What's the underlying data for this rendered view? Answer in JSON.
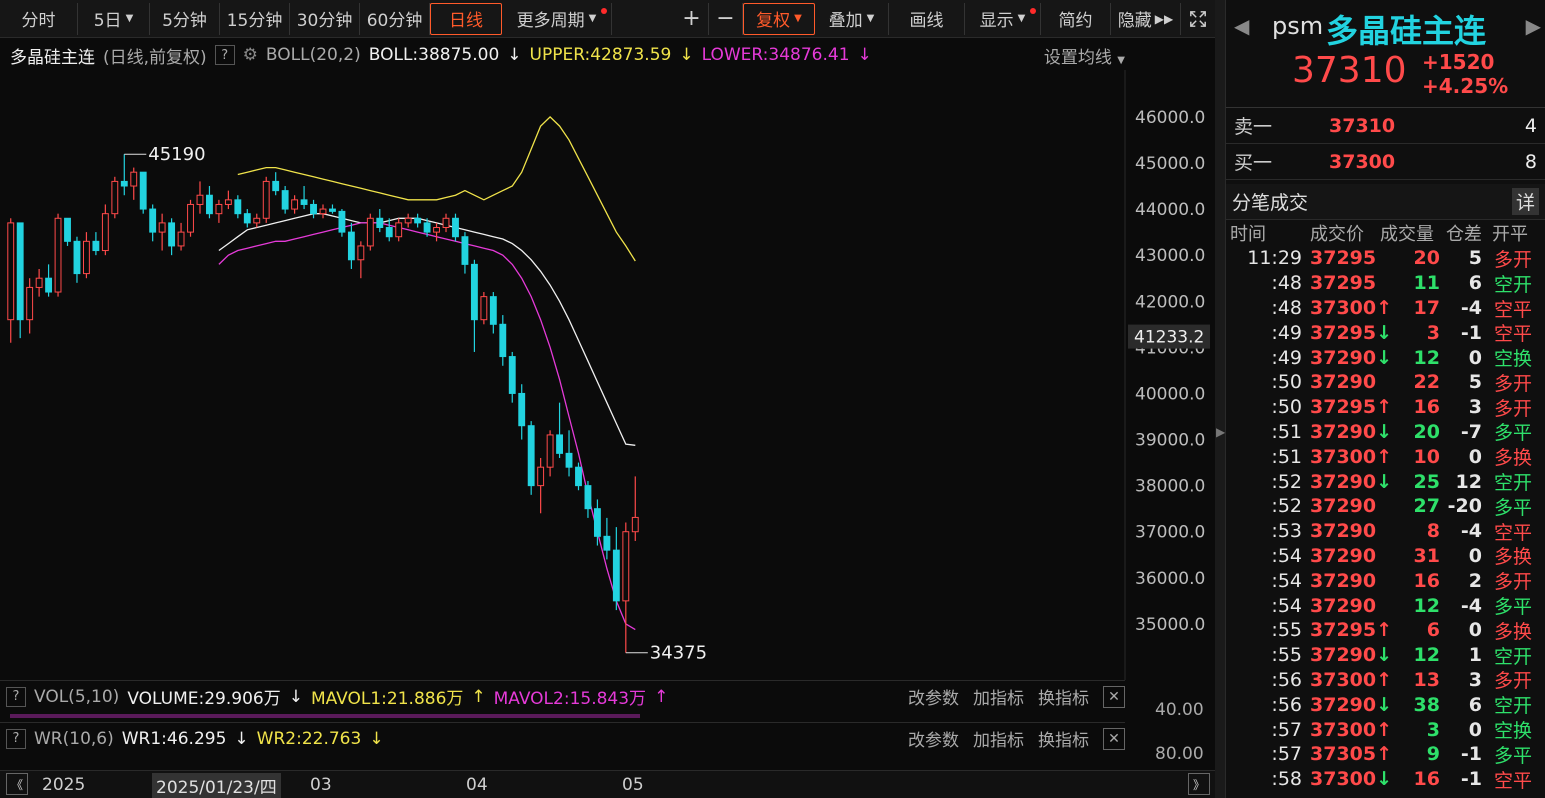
{
  "toolbar": {
    "periods": [
      "分时",
      "5日",
      "5分钟",
      "15分钟",
      "30分钟",
      "60分钟",
      "日线",
      "更多周期"
    ],
    "active_period": "日线",
    "tools": [
      "+",
      "−",
      "复权",
      "叠加",
      "画线",
      "显示",
      "简约",
      "隐藏"
    ]
  },
  "legend": {
    "symbol": "多晶硅主连",
    "mode": "(日线,前复权)",
    "indicator": "BOLL(20,2)",
    "boll": "BOLL:38875.00",
    "upper": "UPPER:42873.59",
    "lower": "LOWER:34876.41",
    "settings": "设置均线"
  },
  "colors": {
    "up": "#ff4a4a",
    "down": "#22d3e0",
    "mid": "#f0f0f0",
    "upper": "#f0e34a",
    "lower": "#e53ad8"
  },
  "chart_data": {
    "type": "candlestick",
    "price_axis_ticks": [
      "46000.0",
      "45000.0",
      "44000.0",
      "43000.0",
      "42000.0",
      "41000.0",
      "40000.0",
      "39000.0",
      "38000.0",
      "37000.0",
      "36000.0",
      "35000.0"
    ],
    "crosshair_price": "41233.2",
    "high_label": "45190",
    "low_label": "34375",
    "x_labels": [
      "2025",
      "03",
      "04",
      "05"
    ],
    "date_cursor": "2025/01/23/四",
    "candles": [
      [
        41600,
        43800,
        41100,
        43700
      ],
      [
        43700,
        43700,
        41200,
        41600
      ],
      [
        41600,
        42500,
        41300,
        42300
      ],
      [
        42300,
        42700,
        42100,
        42500
      ],
      [
        42500,
        42800,
        42100,
        42200
      ],
      [
        42200,
        43900,
        42100,
        43800
      ],
      [
        43800,
        43800,
        43200,
        43300
      ],
      [
        43300,
        43400,
        42400,
        42600
      ],
      [
        42600,
        43500,
        42500,
        43300
      ],
      [
        43300,
        43500,
        43000,
        43100
      ],
      [
        43100,
        44100,
        43000,
        43900
      ],
      [
        43900,
        44700,
        43800,
        44600
      ],
      [
        44600,
        45190,
        44300,
        44500
      ],
      [
        44500,
        44900,
        44200,
        44800
      ],
      [
        44800,
        44800,
        43900,
        44000
      ],
      [
        44000,
        44100,
        43300,
        43500
      ],
      [
        43500,
        43900,
        43100,
        43700
      ],
      [
        43700,
        43800,
        43000,
        43200
      ],
      [
        43200,
        43700,
        43100,
        43500
      ],
      [
        43500,
        44200,
        43400,
        44100
      ],
      [
        44100,
        44600,
        43900,
        44300
      ],
      [
        44300,
        44500,
        43800,
        43900
      ],
      [
        43900,
        44200,
        43700,
        44100
      ],
      [
        44100,
        44400,
        44000,
        44200
      ],
      [
        44200,
        44300,
        43800,
        43900
      ],
      [
        43900,
        44000,
        43600,
        43700
      ],
      [
        43700,
        43900,
        43600,
        43800
      ],
      [
        43800,
        44700,
        43700,
        44600
      ],
      [
        44600,
        44800,
        44300,
        44400
      ],
      [
        44400,
        44500,
        43900,
        44000
      ],
      [
        44000,
        44300,
        43900,
        44200
      ],
      [
        44200,
        44500,
        44000,
        44100
      ],
      [
        44100,
        44200,
        43800,
        43900
      ],
      [
        43900,
        44100,
        43800,
        44000
      ],
      [
        44000,
        44100,
        43900,
        43950
      ],
      [
        43950,
        44000,
        43400,
        43500
      ],
      [
        43500,
        43700,
        42700,
        42900
      ],
      [
        42900,
        43300,
        42500,
        43200
      ],
      [
        43200,
        43900,
        43100,
        43800
      ],
      [
        43800,
        44000,
        43500,
        43600
      ],
      [
        43600,
        43800,
        43300,
        43400
      ],
      [
        43400,
        43800,
        43300,
        43700
      ],
      [
        43700,
        43900,
        43600,
        43800
      ],
      [
        43800,
        43900,
        43600,
        43700
      ],
      [
        43700,
        43800,
        43400,
        43500
      ],
      [
        43500,
        43700,
        43300,
        43600
      ],
      [
        43600,
        43900,
        43500,
        43800
      ],
      [
        43800,
        43900,
        43300,
        43400
      ],
      [
        43400,
        43500,
        42600,
        42800
      ],
      [
        42800,
        42900,
        40900,
        41600
      ],
      [
        41600,
        42200,
        41500,
        42100
      ],
      [
        42100,
        42200,
        41300,
        41500
      ],
      [
        41500,
        41700,
        40600,
        40800
      ],
      [
        40800,
        40900,
        39800,
        40000
      ],
      [
        40000,
        40200,
        39000,
        39300
      ],
      [
        39300,
        39400,
        37800,
        38000
      ],
      [
        38000,
        38600,
        37400,
        38400
      ],
      [
        38400,
        39200,
        38200,
        39100
      ],
      [
        39100,
        39800,
        38600,
        38700
      ],
      [
        38700,
        39200,
        38200,
        38400
      ],
      [
        38400,
        38500,
        37900,
        38000
      ],
      [
        38000,
        38100,
        37300,
        37500
      ],
      [
        37500,
        37700,
        36700,
        36900
      ],
      [
        36900,
        37300,
        36400,
        36600
      ],
      [
        36600,
        37100,
        35300,
        35500
      ],
      [
        35500,
        37200,
        34375,
        37000
      ],
      [
        37000,
        38200,
        36800,
        37310
      ]
    ],
    "mid": [
      43100,
      43250,
      43400,
      43550,
      43600,
      43650,
      43700,
      43750,
      43800,
      43850,
      43900,
      43900,
      43850,
      43800,
      43750,
      43700,
      43700,
      43700,
      43750,
      43800,
      43800,
      43800,
      43750,
      43700,
      43650,
      43600,
      43550,
      43500,
      43450,
      43400,
      43350,
      43250,
      43100,
      42900,
      42650,
      42350,
      42000,
      41600,
      41150,
      40700,
      40250,
      39800,
      39350,
      38900,
      38875
    ],
    "upper": [
      44750,
      44800,
      44850,
      44900,
      44900,
      44850,
      44800,
      44750,
      44700,
      44650,
      44600,
      44550,
      44500,
      44450,
      44400,
      44350,
      44300,
      44250,
      44200,
      44200,
      44200,
      44200,
      44250,
      44300,
      44400,
      44300,
      44200,
      44300,
      44400,
      44500,
      44800,
      45300,
      45800,
      46000,
      45800,
      45500,
      45100,
      44700,
      44300,
      43900,
      43500,
      43200,
      42873
    ],
    "lower": [
      42800,
      43000,
      43100,
      43150,
      43200,
      43250,
      43300,
      43300,
      43350,
      43400,
      43450,
      43500,
      43550,
      43600,
      43650,
      43700,
      43700,
      43700,
      43650,
      43600,
      43550,
      43500,
      43450,
      43400,
      43350,
      43300,
      43250,
      43200,
      43150,
      43100,
      43000,
      42800,
      42500,
      42100,
      41600,
      41000,
      40300,
      39500,
      38700,
      37800,
      37000,
      36200,
      35500,
      35000,
      34876
    ]
  },
  "vol_row": {
    "indicator": "VOL(5,10)",
    "volume": "VOLUME:29.906万",
    "mavol1": "MAVOL1:21.886万",
    "mavol2": "MAVOL2:15.843万",
    "axis_a": "40.00",
    "axis_b": "80.00",
    "actions": [
      "改参数",
      "加指标",
      "换指标"
    ]
  },
  "wr_row": {
    "indicator": "WR(10,6)",
    "wr1": "WR1:46.295",
    "wr2": "WR2:22.763",
    "axis": "80.00",
    "actions": [
      "改参数",
      "加指标",
      "换指标"
    ]
  },
  "quote": {
    "code": "psm",
    "name": "多晶硅主连",
    "price": "37310",
    "change": "+1520",
    "change_pct": "+4.25%",
    "ask_label": "卖一",
    "ask_price": "37310",
    "ask_vol": "4",
    "bid_label": "买一",
    "bid_price": "37300",
    "bid_vol": "8"
  },
  "trades": {
    "title": "分笔成交",
    "detail": "详",
    "headers": [
      "时间",
      "成交价",
      "成交量",
      "仓差",
      "开平"
    ],
    "rows": [
      {
        "time": "11:29",
        "price": "37295",
        "arrow": "",
        "vol": "20",
        "oi": "5",
        "type": "多开",
        "pc": "red",
        "vc": "red",
        "tc": "red"
      },
      {
        "time": ":48",
        "price": "37295",
        "arrow": "",
        "vol": "11",
        "oi": "6",
        "type": "空开",
        "pc": "red",
        "vc": "green",
        "tc": "green"
      },
      {
        "time": ":48",
        "price": "37300",
        "arrow": "↑",
        "vol": "17",
        "oi": "-4",
        "type": "空平",
        "pc": "red",
        "vc": "red",
        "tc": "red"
      },
      {
        "time": ":49",
        "price": "37295",
        "arrow": "↓",
        "vol": "3",
        "oi": "-1",
        "type": "空平",
        "pc": "red",
        "vc": "red",
        "tc": "red"
      },
      {
        "time": ":49",
        "price": "37290",
        "arrow": "↓",
        "vol": "12",
        "oi": "0",
        "type": "空换",
        "pc": "red",
        "vc": "green",
        "tc": "green"
      },
      {
        "time": ":50",
        "price": "37290",
        "arrow": "",
        "vol": "22",
        "oi": "5",
        "type": "多开",
        "pc": "red",
        "vc": "red",
        "tc": "red"
      },
      {
        "time": ":50",
        "price": "37295",
        "arrow": "↑",
        "vol": "16",
        "oi": "3",
        "type": "多开",
        "pc": "red",
        "vc": "red",
        "tc": "red"
      },
      {
        "time": ":51",
        "price": "37290",
        "arrow": "↓",
        "vol": "20",
        "oi": "-7",
        "type": "多平",
        "pc": "red",
        "vc": "green",
        "tc": "green"
      },
      {
        "time": ":51",
        "price": "37300",
        "arrow": "↑",
        "vol": "10",
        "oi": "0",
        "type": "多换",
        "pc": "red",
        "vc": "red",
        "tc": "red"
      },
      {
        "time": ":52",
        "price": "37290",
        "arrow": "↓",
        "vol": "25",
        "oi": "12",
        "type": "空开",
        "pc": "red",
        "vc": "green",
        "tc": "green"
      },
      {
        "time": ":52",
        "price": "37290",
        "arrow": "",
        "vol": "27",
        "oi": "-20",
        "type": "多平",
        "pc": "red",
        "vc": "green",
        "tc": "green"
      },
      {
        "time": ":53",
        "price": "37290",
        "arrow": "",
        "vol": "8",
        "oi": "-4",
        "type": "空平",
        "pc": "red",
        "vc": "red",
        "tc": "red"
      },
      {
        "time": ":54",
        "price": "37290",
        "arrow": "",
        "vol": "31",
        "oi": "0",
        "type": "多换",
        "pc": "red",
        "vc": "red",
        "tc": "red"
      },
      {
        "time": ":54",
        "price": "37290",
        "arrow": "",
        "vol": "16",
        "oi": "2",
        "type": "多开",
        "pc": "red",
        "vc": "red",
        "tc": "red"
      },
      {
        "time": ":54",
        "price": "37290",
        "arrow": "",
        "vol": "12",
        "oi": "-4",
        "type": "多平",
        "pc": "red",
        "vc": "green",
        "tc": "green"
      },
      {
        "time": ":55",
        "price": "37295",
        "arrow": "↑",
        "vol": "6",
        "oi": "0",
        "type": "多换",
        "pc": "red",
        "vc": "red",
        "tc": "red"
      },
      {
        "time": ":55",
        "price": "37290",
        "arrow": "↓",
        "vol": "12",
        "oi": "1",
        "type": "空开",
        "pc": "red",
        "vc": "green",
        "tc": "green"
      },
      {
        "time": ":56",
        "price": "37300",
        "arrow": "↑",
        "vol": "13",
        "oi": "3",
        "type": "多开",
        "pc": "red",
        "vc": "red",
        "tc": "red"
      },
      {
        "time": ":56",
        "price": "37290",
        "arrow": "↓",
        "vol": "38",
        "oi": "6",
        "type": "空开",
        "pc": "red",
        "vc": "green",
        "tc": "green"
      },
      {
        "time": ":57",
        "price": "37300",
        "arrow": "↑",
        "vol": "3",
        "oi": "0",
        "type": "空换",
        "pc": "red",
        "vc": "green",
        "tc": "green"
      },
      {
        "time": ":57",
        "price": "37305",
        "arrow": "↑",
        "vol": "9",
        "oi": "-1",
        "type": "多平",
        "pc": "red",
        "vc": "green",
        "tc": "green"
      },
      {
        "time": ":58",
        "price": "37300",
        "arrow": "↓",
        "vol": "16",
        "oi": "-1",
        "type": "空平",
        "pc": "red",
        "vc": "red",
        "tc": "red"
      }
    ]
  }
}
